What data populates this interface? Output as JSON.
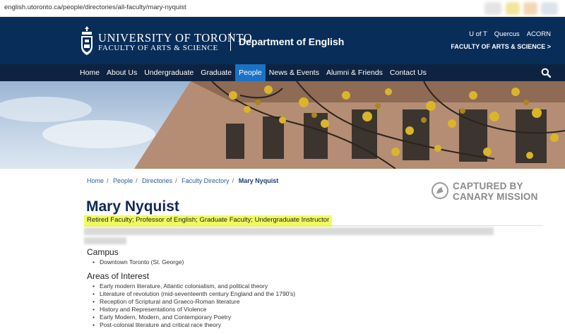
{
  "browser": {
    "url": "english.utoronto.ca/people/directories/all-faculty/mary-nyquist"
  },
  "header": {
    "university_line1": "UNIVERSITY OF TORONTO",
    "university_line2": "FACULTY OF ARTS & SCIENCE",
    "department": "Department of English",
    "utility_links": [
      "U of T",
      "Quercus",
      "ACORN"
    ],
    "faculty_link": "FACULTY OF ARTS & SCIENCE >"
  },
  "nav": {
    "items": [
      "Home",
      "About Us",
      "Undergraduate",
      "Graduate",
      "People",
      "News & Events",
      "Alumni & Friends",
      "Contact Us"
    ],
    "active_index": 4
  },
  "breadcrumb": {
    "items": [
      "Home",
      "People",
      "Directories",
      "Faculty Directory"
    ],
    "current": "Mary Nyquist"
  },
  "stamp": {
    "line1": "CAPTURED BY",
    "line2": "CANARY MISSION"
  },
  "profile": {
    "name": "Mary Nyquist",
    "roles": "Retired Faculty; Professor of English; Graduate Faculty; Undergraduate Instructor",
    "campus_heading": "Campus",
    "campus": [
      "Downtown Toronto (St. George)"
    ],
    "areas_heading": "Areas of Interest",
    "areas": [
      "Early modern literature, Atlantic colonialism, and political theory",
      "Literature of revolution (mid-seventeenth century England and the 1790's)",
      "Reception of Scriptural and Graeco-Roman literature",
      "History and Representations of Violence",
      "Early Modern, Modern, and Contemporary Poetry",
      "Post-colonial literature and critical race theory"
    ]
  },
  "colors": {
    "header_bg": "#082d59",
    "nav_bg": "#0e2342",
    "nav_active": "#1b72c5",
    "highlight": "#f0fb60",
    "title": "#10285a"
  },
  "icons": {
    "crest": "university-crest-icon",
    "search": "search-icon",
    "stamp": "canary-mission-logo-icon"
  }
}
